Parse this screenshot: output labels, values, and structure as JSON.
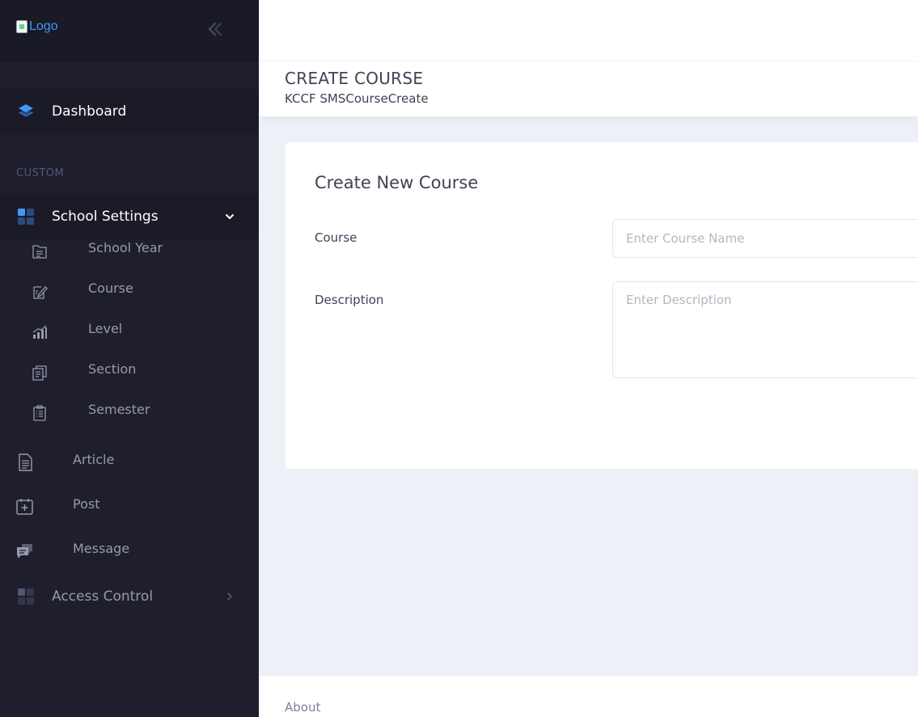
{
  "app": {
    "logo_alt": "Logo"
  },
  "sidebar": {
    "dashboard_label": "Dashboard",
    "section_label": "CUSTOM",
    "school_settings_label": "School Settings",
    "sub_items": [
      {
        "label": "School Year",
        "icon": "folder-doc-icon"
      },
      {
        "label": "Course",
        "icon": "edit-note-icon"
      },
      {
        "label": "Level",
        "icon": "bar-chart-icon"
      },
      {
        "label": "Section",
        "icon": "copy-doc-icon"
      },
      {
        "label": "Semester",
        "icon": "clipboard-list-icon"
      }
    ],
    "plain_items": [
      {
        "label": "Article",
        "icon": "document-icon"
      },
      {
        "label": "Post",
        "icon": "calendar-add-icon"
      },
      {
        "label": "Message",
        "icon": "chat-bubbles-icon"
      }
    ],
    "access_control_label": "Access Control"
  },
  "toolbar": {
    "page_title": "CREATE COURSE",
    "breadcrumb": "KCCF SMSCourseCreate"
  },
  "form": {
    "title": "Create New Course",
    "course_label": "Course",
    "course_placeholder": "Enter Course Name",
    "course_value": "",
    "description_label": "Description",
    "description_placeholder": "Enter Description",
    "description_value": ""
  },
  "footer": {
    "about_label": "About"
  },
  "colors": {
    "sidebar_bg": "#1e1e2d",
    "accent": "#3e97ff",
    "text_dark": "#3f4254",
    "text_muted": "#9899ac"
  }
}
